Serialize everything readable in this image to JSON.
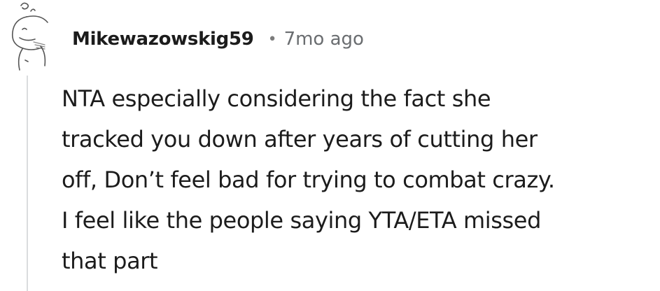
{
  "comment": {
    "username": "Mikewazowskig59",
    "separator": "•",
    "timestamp": "7mo ago",
    "body_lines": [
      "NTA especially considering the fact she",
      "tracked you down after years of cutting her",
      "off, Don’t feel bad for trying to combat crazy.",
      "I feel like the people saying YTA/ETA missed",
      "that part"
    ],
    "avatar_icon": "snoo-sketch-avatar-icon"
  },
  "colors": {
    "text": "#1c1c1c",
    "meta": "#6a6d70",
    "thread_line": "#dadcde"
  }
}
